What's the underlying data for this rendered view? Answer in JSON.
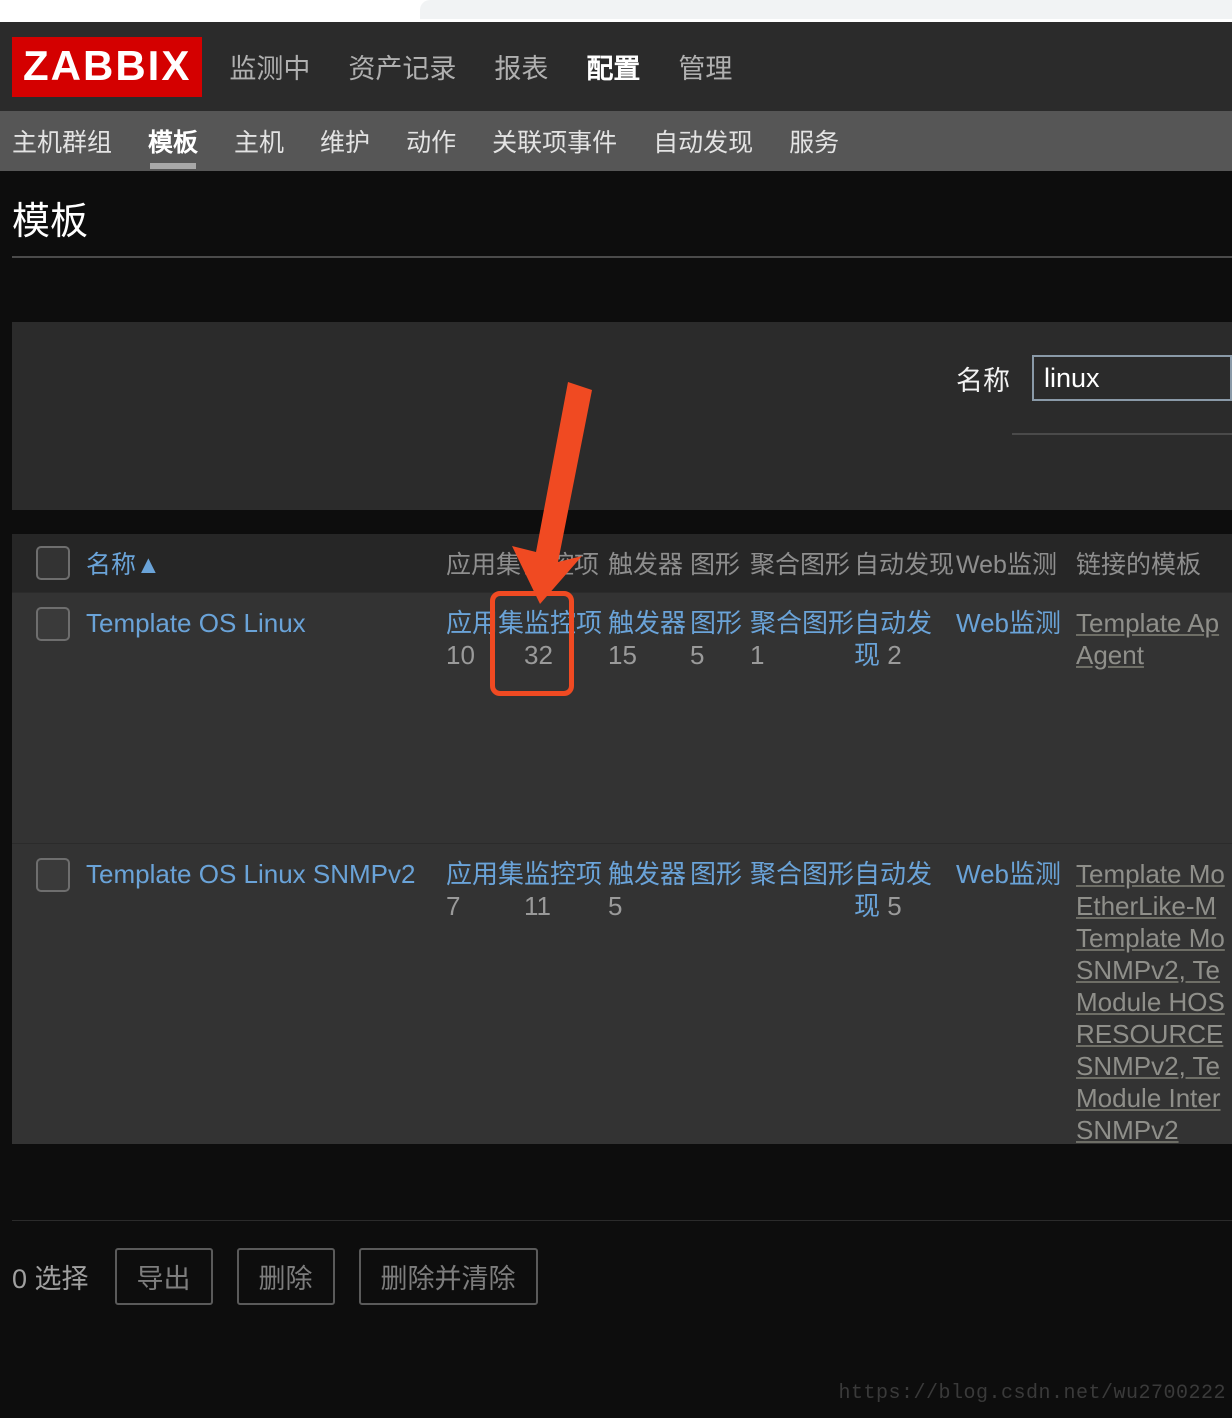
{
  "brand": {
    "logo": "ZABBIX",
    "logo_bg": "#d40000"
  },
  "topnav": {
    "items": [
      {
        "label": "监测中",
        "active": false
      },
      {
        "label": "资产记录",
        "active": false
      },
      {
        "label": "报表",
        "active": false
      },
      {
        "label": "配置",
        "active": true
      },
      {
        "label": "管理",
        "active": false
      }
    ]
  },
  "subnav": {
    "items": [
      {
        "label": "主机群组",
        "active": false
      },
      {
        "label": "模板",
        "active": true
      },
      {
        "label": "主机",
        "active": false
      },
      {
        "label": "维护",
        "active": false
      },
      {
        "label": "动作",
        "active": false
      },
      {
        "label": "关联项事件",
        "active": false
      },
      {
        "label": "自动发现",
        "active": false
      },
      {
        "label": "服务",
        "active": false
      }
    ]
  },
  "page": {
    "title": "模板"
  },
  "filter": {
    "name_label": "名称",
    "name_value": "linux",
    "name_placeholder": ""
  },
  "table": {
    "headers": {
      "name": "名称",
      "sort_arrow": "▲",
      "applications": "应用集",
      "items": "监控项",
      "triggers": "触发器",
      "graphs": "图形",
      "screens": "聚合图形",
      "discovery": "自动发现",
      "web": "Web监测",
      "linked": "链接的模板"
    },
    "rows": [
      {
        "name": "Template OS Linux",
        "applications": {
          "label": "应用集",
          "count": "10"
        },
        "items": {
          "label": "监控项",
          "count": "32"
        },
        "triggers": {
          "label": "触发器",
          "count": "15"
        },
        "graphs": {
          "label": "图形",
          "count": "5"
        },
        "screens": {
          "label": "聚合图形",
          "count": "1"
        },
        "discovery": {
          "label": "自动发现",
          "count": "2"
        },
        "web": {
          "label": "Web监测",
          "count": ""
        },
        "linked_templates": [
          "Template Ap",
          "Agent"
        ]
      },
      {
        "name": "Template OS Linux SNMPv2",
        "applications": {
          "label": "应用集",
          "count": "7"
        },
        "items": {
          "label": "监控项",
          "count": "11"
        },
        "triggers": {
          "label": "触发器",
          "count": "5"
        },
        "graphs": {
          "label": "图形",
          "count": ""
        },
        "screens": {
          "label": "聚合图形",
          "count": ""
        },
        "discovery": {
          "label": "自动发现",
          "count": "5"
        },
        "web": {
          "label": "Web监测",
          "count": ""
        },
        "linked_templates": [
          "Template Mo",
          "EtherLike-M",
          "Template Mo",
          "SNMPv2, Te",
          "Module HOS",
          "RESOURCE",
          "SNMPv2, Te",
          "Module Inter",
          "SNMPv2"
        ]
      }
    ]
  },
  "footer": {
    "selected_text": "0 选择",
    "buttons": [
      {
        "label": "导出"
      },
      {
        "label": "删除"
      },
      {
        "label": "删除并清除"
      }
    ]
  },
  "annotation": {
    "arrow_color": "#f04a22",
    "highlight_color": "#f04a22",
    "highlight_target": "监控项 32"
  },
  "watermark": {
    "text": "https://blog.csdn.net/wu2700222"
  }
}
